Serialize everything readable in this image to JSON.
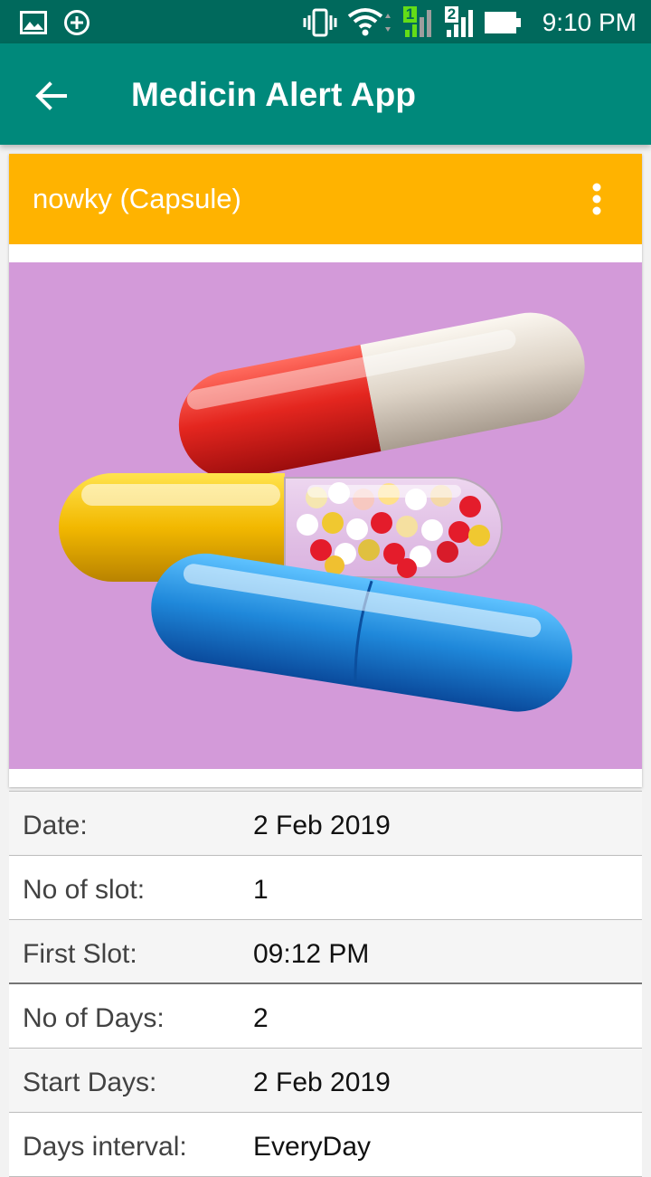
{
  "status_bar": {
    "time": "9:10 PM",
    "sim1": "1",
    "sim2": "2",
    "icons": [
      "gallery-icon",
      "add-circle-icon",
      "vibrate-icon",
      "wifi-icon",
      "signal-icon",
      "battery-icon"
    ]
  },
  "app_bar": {
    "title": "Medicin Alert App"
  },
  "medicine_card": {
    "title": "nowky (Capsule)",
    "header_color": "#ffb300",
    "image_background": "#d39ad9",
    "image_subject": "capsules"
  },
  "details": [
    {
      "label": "Date:",
      "value": "2 Feb 2019"
    },
    {
      "label": "No of slot:",
      "value": "1"
    },
    {
      "label": "First Slot:",
      "value": "09:12 PM"
    },
    {
      "label": "No of Days:",
      "value": "2"
    },
    {
      "label": "Start Days:",
      "value": "2 Feb 2019"
    },
    {
      "label": "Days interval:",
      "value": "EveryDay"
    }
  ],
  "colors": {
    "status_bar": "#00695c",
    "app_bar": "#00897b"
  }
}
